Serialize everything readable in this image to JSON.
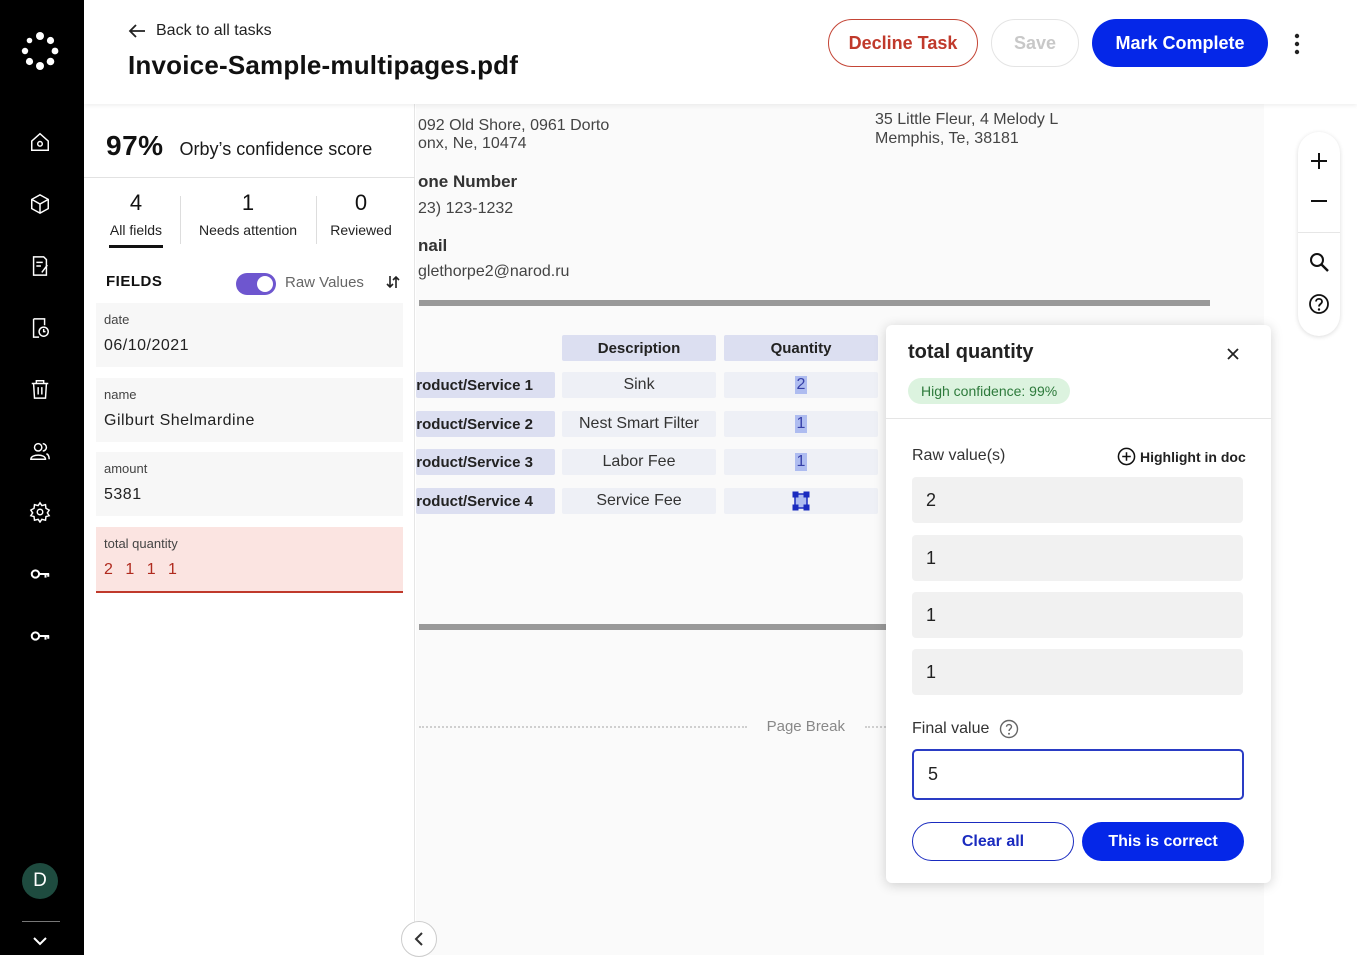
{
  "header": {
    "back_label": "Back to all tasks",
    "title": "Invoice-Sample-multipages.pdf",
    "decline_label": "Decline Task",
    "save_label": "Save",
    "complete_label": "Mark Complete"
  },
  "rail": {
    "avatar_initial": "D",
    "icons": [
      "home-icon",
      "cube-icon",
      "document-edit-icon",
      "document-history-icon",
      "trash-icon",
      "users-icon",
      "gear-icon",
      "key-icon",
      "key-icon"
    ]
  },
  "panel": {
    "confidence_pct": "97%",
    "confidence_label": "Orby’s confidence score",
    "stats": [
      {
        "num": "4",
        "label": "All fields"
      },
      {
        "num": "1",
        "label": "Needs attention"
      },
      {
        "num": "0",
        "label": "Reviewed"
      }
    ],
    "fields_header": "FIELDS",
    "raw_values_label": "Raw Values",
    "raw_values_on": true,
    "fields": [
      {
        "key": "date",
        "value": "06/10/2021"
      },
      {
        "key": "name",
        "value": "Gilburt Shelmardine"
      },
      {
        "key": "amount",
        "value": "5381"
      },
      {
        "key": "total quantity",
        "value": "2 1 1 1"
      }
    ]
  },
  "doc": {
    "address_left_1": "092 Old Shore, 0961 Dorto",
    "address_left_2": "onx, Ne, 10474",
    "address_right_1": "35 Little Fleur, 4 Melody L",
    "address_right_2": "Memphis, Te, 38181",
    "phone_label": "one Number",
    "phone_value": "23) 123-1232",
    "email_label": "nail",
    "email_value": "glethorpe2@narod.ru",
    "table_headers": [
      "Description",
      "Quantity"
    ],
    "rows": [
      {
        "item": "roduct/Service 1",
        "description": "Sink",
        "quantity": "2"
      },
      {
        "item": "roduct/Service 2",
        "description": "Nest Smart Filter",
        "quantity": "1"
      },
      {
        "item": "roduct/Service 3",
        "description": "Labor Fee",
        "quantity": "1"
      },
      {
        "item": "roduct/Service 4",
        "description": "Service Fee",
        "quantity": ""
      }
    ],
    "page_break_label": "Page Break"
  },
  "popup": {
    "title": "total quantity",
    "confidence_badge": "High confidence: 99%",
    "raw_values_label": "Raw value(s)",
    "highlight_label": "Highlight in doc",
    "raw_values": [
      "2",
      "1",
      "1",
      "1"
    ],
    "final_value_label": "Final value",
    "final_value": "5",
    "clear_label": "Clear all",
    "correct_label": "This is correct"
  },
  "colors": {
    "primary": "#0527e8",
    "decline": "#c0392b",
    "toggle": "#6e56cf",
    "attention_bg": "#fbe4e1",
    "badge_bg": "#dcf3df"
  }
}
